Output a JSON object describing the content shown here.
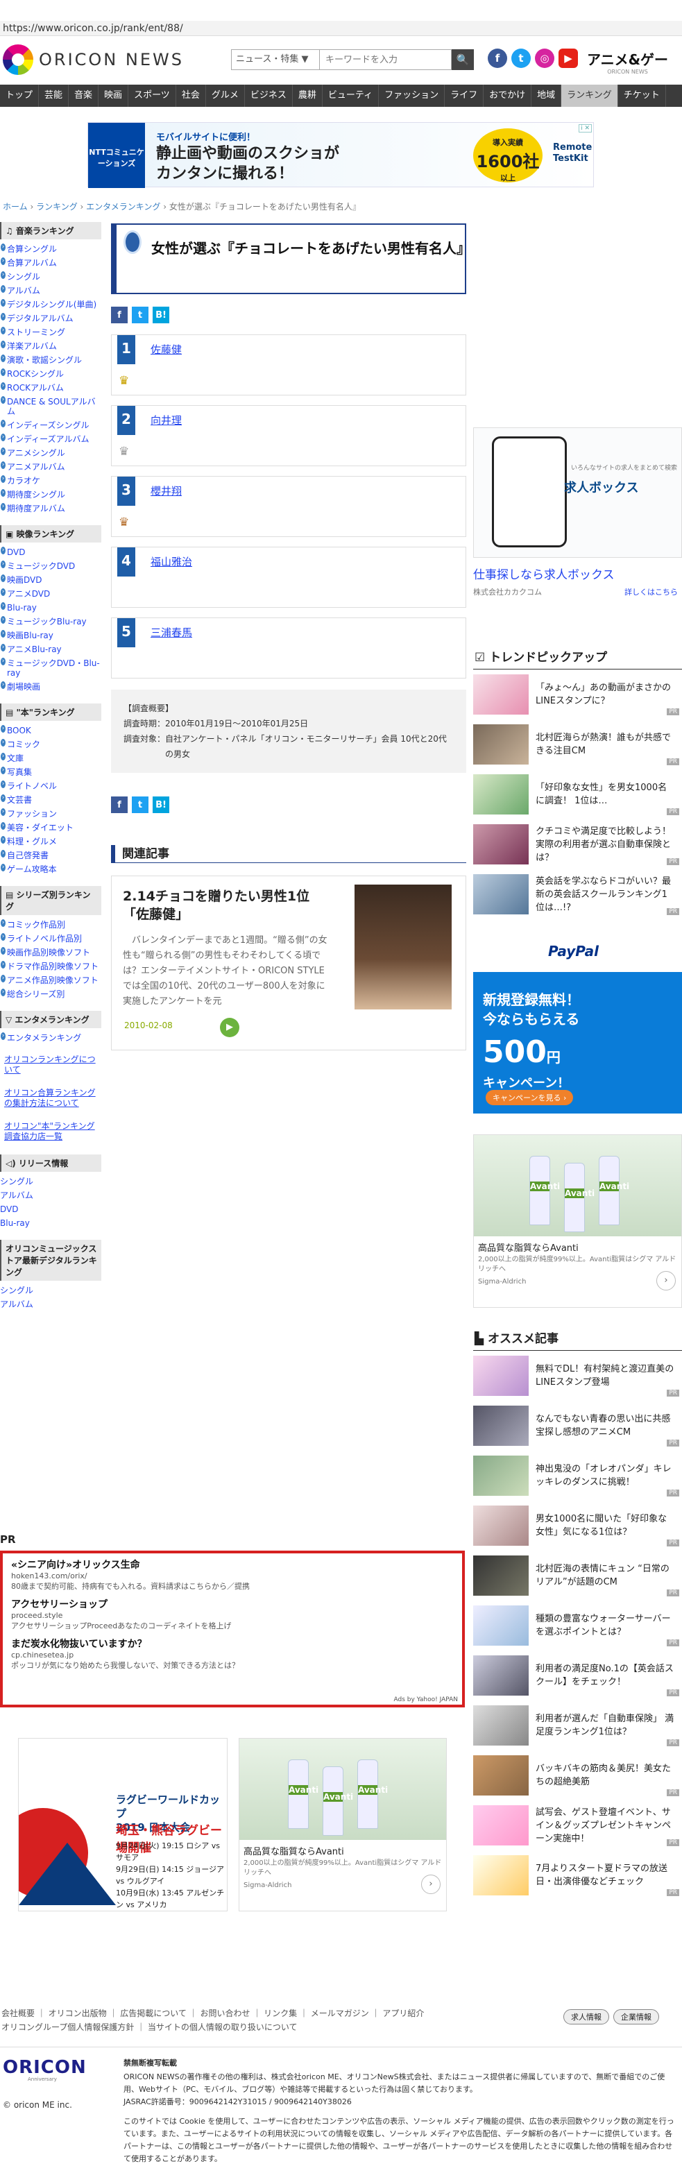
{
  "url": "https://www.oricon.co.jp/rank/ent/88/",
  "brand": {
    "name": "ORICON NEWS"
  },
  "search": {
    "scope": "ニュース・特集 ▼",
    "placeholder": "キーワードを入力",
    "button": "🔍"
  },
  "sns": [
    "f",
    "t",
    "◎",
    "▶"
  ],
  "anime": {
    "title": "アニメ&ゲー",
    "sub": "ORICON NEWS"
  },
  "nav": [
    "トップ",
    "芸能",
    "音楽",
    "映画",
    "スポーツ",
    "社会",
    "グルメ",
    "ビジネス",
    "農耕",
    "ビューティ",
    "ファッション",
    "ライフ",
    "おでかけ",
    "地域",
    "ランキング",
    "チケット"
  ],
  "nav_active": 14,
  "banner": {
    "brand": "NTTコミュニケーションズ",
    "lead": "モバイルサイトに便利！",
    "headline1": "静止画や動画のスクショが",
    "headline2": "カンタンに撮れる！",
    "badge_top": "導入実績",
    "badge_num": "1600社",
    "badge_bottom": "以上",
    "product": "Remote TestKit",
    "ad": "i ✕"
  },
  "breadcrumb": {
    "home": "ホーム",
    "ranking": "ランキング",
    "ent": "エンタメランキング",
    "current": "女性が選ぶ『チョコレートをあげたい男性有名人』",
    "sep": " › "
  },
  "sidebar": {
    "music": {
      "title": "♫ 音楽ランキング",
      "items": [
        "合算シングル",
        "合算アルバム",
        "シングル",
        "アルバム",
        "デジタルシングル(単曲)",
        "デジタルアルバム",
        "ストリーミング",
        "洋楽アルバム",
        "演歌・歌謡シングル",
        "ROCKシングル",
        "ROCKアルバム",
        "DANCE & SOULアルバム",
        "インディーズシングル",
        "インディーズアルバム",
        "アニメシングル",
        "アニメアルバム",
        "カラオケ",
        "期待度シングル",
        "期待度アルバム"
      ]
    },
    "video": {
      "title": "▣ 映像ランキング",
      "items": [
        "DVD",
        "ミュージックDVD",
        "映画DVD",
        "アニメDVD",
        "Blu-ray",
        "ミュージックBlu-ray",
        "映画Blu-ray",
        "アニメBlu-ray",
        "ミュージックDVD・Blu-ray",
        "劇場映画"
      ]
    },
    "books": {
      "title": "▤ \"本\"ランキング",
      "items": [
        "BOOK",
        "コミック",
        "文庫",
        "写真集",
        "ライトノベル",
        "文芸書",
        "ファッション",
        "美容・ダイエット",
        "料理・グルメ",
        "自己啓発書",
        "ゲーム攻略本"
      ]
    },
    "series": {
      "title": "▤ シリーズ別ランキング",
      "items": [
        "コミック作品別",
        "ライトノベル作品別",
        "映画作品別映像ソフト",
        "ドラマ作品別映像ソフト",
        "アニメ作品別映像ソフト",
        "総合シリーズ別"
      ]
    },
    "ent": {
      "title": "▽ エンタメランキング",
      "items": [
        "エンタメランキング"
      ]
    },
    "links": [
      "オリコンランキングについて",
      "オリコン合算ランキングの集計方法について",
      "オリコン\"本\"ランキング調査協力店一覧"
    ],
    "release": {
      "title": "◁) リリース情報",
      "items": [
        "シングル",
        "アルバム",
        "DVD",
        "Blu-ray"
      ]
    },
    "store": {
      "title": "オリコンミュージックストア最新デジタルランキング",
      "items": [
        "シングル",
        "アルバム"
      ]
    }
  },
  "article": {
    "title": "女性が選ぶ『チョコレートをあげたい男性有名人』",
    "share": [
      "f",
      "t",
      "B!"
    ],
    "ranks": [
      {
        "num": "1",
        "name": "佐藤健",
        "crown": "♛",
        "crown_color": "#c8a200"
      },
      {
        "num": "2",
        "name": "向井理",
        "crown": "♛",
        "crown_color": "#9a9a9a"
      },
      {
        "num": "3",
        "name": "櫻井翔",
        "crown": "♛",
        "crown_color": "#b87333"
      },
      {
        "num": "4",
        "name": "福山雅治"
      },
      {
        "num": "5",
        "name": "三浦春馬"
      }
    ],
    "survey": {
      "heading": "【調査概要】",
      "period_label": "調査時期：",
      "period": "2010年01月19日〜2010年01月25日",
      "target_label": "調査対象：",
      "target": "自社アンケート・パネル「オリコン・モニターリサーチ」会員 10代と20代 の男女"
    },
    "related_title": "関連記事",
    "related": {
      "title": "2.14チョコを贈りたい男性1位「佐藤健」",
      "body": "バレンタインデーまであと1週間。“贈る側”の女性も“贈られる側”の男性もそわそわしてくる頃では？エンターテイメントサイト・ORICON STYLEでは全国の10代、20代のユーザー800人を対象に実施したアンケートを元",
      "date": "2010-02-08",
      "go": "▶"
    }
  },
  "right": {
    "recruit": {
      "logo": "求人ボックス",
      "tagline": "いろんなサイトの求人をまとめて検索",
      "link": "仕事探しなら求人ボックス",
      "company": "株式会社カカクコム",
      "more": "詳しくはこちら"
    },
    "trend_title": "トレンドピックアップ",
    "trends": [
      "「みょ〜ん」あの動画がまさかのLINEスタンプに？",
      "北村匠海らが熱演！誰もが共感できる注目CM",
      "「好印象な女性」を男女1000名に調査！ 1位は…",
      "クチコミや満足度で比較しよう！実際の利用者が選ぶ自動車保険とは？",
      "英会話を学ぶならドコがいい？最新の英会話スクールランキング1位は…!?"
    ],
    "pr": "PR",
    "paypal": {
      "logo": "PayPal",
      "line1": "新規登録無料！",
      "line2": "今ならもらえる",
      "amount": "500",
      "unit": "円",
      "line3": "キャンペーン！",
      "cta": "キャンペーンを見る ›"
    },
    "avanti": {
      "title": "高品質な脂質ならAvanti",
      "desc1": "2,000以上の脂質が純度99%以上。Avanti脂質はシグマ アルドリッチへ",
      "sponsor": "Sigma-Aldrich",
      "bottle": "Avanti",
      "arrow": "›"
    },
    "osusume_title": "オススメ記事",
    "osusume": [
      "無料でDL！有村架純と渡辺直美のLINEスタンプ登場",
      "なんでもない青春の思い出に共感 宝探し感想のアニメCM",
      "神出鬼没の「オレオパンダ」キレッキレのダンスに挑戦！",
      "男女1000名に聞いた「好印象な女性」気になる1位は？",
      "北村匠海の表情にキュン “日常のリアル”が話題のCM",
      "種類の豊富なウォーターサーバーを選ぶポイントとは？",
      "利用者の満足度No.1の【英会話スクール】をチェック！",
      "利用者が選んだ「自動車保険」 満足度ランキング1位は？",
      "バッキバキの筋肉＆美尻！美女たちの超絶美筋",
      "試写会、ゲスト登壇イベント、サイン＆グッズプレゼントキャンペーン実施中！",
      "7月よりスタート夏ドラマの放送日・出演俳優などチェック"
    ]
  },
  "pr": {
    "label": "PR",
    "items": [
      {
        "title": "«シニア向け»オリックス生命",
        "url": "hoken143.com/orix/",
        "desc": "80歳まで契約可能、持病有でも入れる。資料請求はこちらから／提携"
      },
      {
        "title": "アクセサリーショップ",
        "url": "proceed.style",
        "desc": "アクセサリーショップProceedあなたのコーディネイトを格上げ"
      },
      {
        "title": "まだ炭水化物抜いていますか？",
        "url": "cp.chinesetea.jp",
        "desc": "ポッコリが気になり始めたら我慢しないで、対策できる方法とは？"
      }
    ],
    "by": "Ads by Yahoo! JAPAN"
  },
  "rugby": {
    "title1": "ラグビーワールドカップ",
    "title2": "2019 日本大会",
    "venue": "埼玉・熊谷ラグビー場開催",
    "m1": "9月24日(火) 19:15 ロシア vs サモア",
    "m2": "9月29日(日) 14:15 ジョージア vs ウルグアイ",
    "m3": "10月9日(水) 13:45 アルゼンチン vs アメリカ"
  },
  "footer": {
    "links1": "会社概要 ｜ オリコン出版物 ｜ 広告掲載について ｜ お問い合わせ ｜ リンク集 ｜ メールマガジン ｜ アプリ紹介",
    "links2": "オリコングループ個人情報保護方針 ｜ 当サイトの個人情報の取り扱いについて",
    "btn1": "求人情報",
    "btn2": "企業情報",
    "logo": "ORICON",
    "logo_sub": "Anniversary",
    "copyright": "© oricon ME inc.",
    "heading": "禁無断複写転載",
    "text1": "ORICON NEWSの著作権その他の権利は、株式会社oricon ME、オリコンNewS株式会社、またはニュース提供者に帰属していますので、無断で番組でのご使用、Webサイト（PC、モバイル、ブログ等）や雑誌等で掲載するといった行為は固く禁じております。",
    "text2": "JASRAC許諾番号：9009642142Y31015 / 9009642140Y38026",
    "text3": "このサイトでは Cookie を使用して、ユーザーに合わせたコンテンツや広告の表示、ソーシャル メディア機能の提供、広告の表示回数やクリック数の測定を行っています。また、ユーザーによるサイトの利用状況についての情報を収集し、ソーシャル メディアや広告配信、データ解析の各パートナーに提供しています。各パートナーは、この情報とユーザーが各パートナーに提供した他の情報や、ユーザーが各パートナーのサービスを使用したときに収集した他の情報を組み合わせて使用することがあります。"
  }
}
